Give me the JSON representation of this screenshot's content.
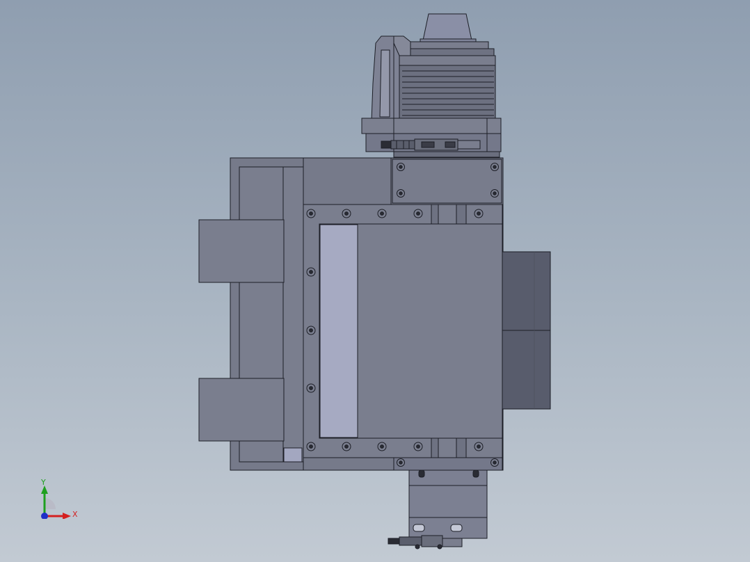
{
  "viewport": {
    "background_top": "#8f9eb0",
    "background_bottom": "#c2cad3"
  },
  "model": {
    "body_color": "#7a7e8e",
    "dark_color": "#565a6a",
    "light_color": "#a6aac2",
    "edge_color": "#1c1e26"
  },
  "triad": {
    "x_label": "X",
    "y_label": "Y",
    "x_color": "#d42020",
    "y_color": "#1fa01f",
    "z_color": "#2030c8"
  }
}
